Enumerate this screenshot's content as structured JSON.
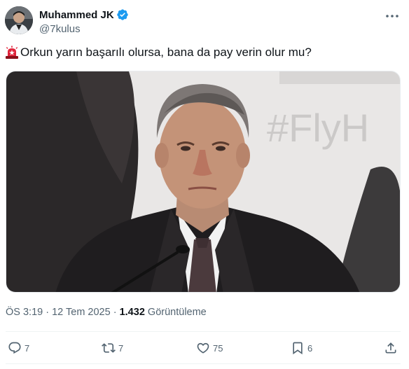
{
  "tweet": {
    "author": {
      "display_name": "Muhammed JK",
      "handle": "@7kulus",
      "verified": true
    },
    "text": "Orkun yarın başarılı olursa, bana da pay verin olur mu?",
    "leading_emoji": "rotating-light-icon",
    "media": {
      "watermark_text": "#FlyH"
    },
    "time": "ÖS 3:19",
    "separator": "·",
    "date": "12 Tem 2025",
    "views": {
      "count": "1.432",
      "label": "Görüntüleme"
    },
    "actions": {
      "replies": "7",
      "retweets": "7",
      "likes": "75",
      "bookmarks": "6"
    }
  },
  "colors": {
    "text_primary": "#0f1419",
    "text_secondary": "#536471",
    "verified_blue": "#1d9bf0",
    "divider": "#eff3f4"
  }
}
